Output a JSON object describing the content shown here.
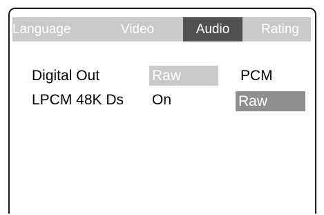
{
  "tabs": [
    {
      "label": "Language",
      "active": false
    },
    {
      "label": "Video",
      "active": false
    },
    {
      "label": "Audio",
      "active": true
    },
    {
      "label": "Rating",
      "active": false
    }
  ],
  "settings": [
    {
      "label": "Digital Out",
      "current_value": "Raw",
      "options": [
        "PCM"
      ]
    },
    {
      "label": "LPCM 48K Ds",
      "current_value": "On",
      "options": [
        "Raw"
      ]
    }
  ],
  "colors": {
    "tab_bar": "#c9c9c9",
    "tab_active": "#505050",
    "selected_option": "#8f8f8f",
    "frame": "#1a1a1a"
  }
}
